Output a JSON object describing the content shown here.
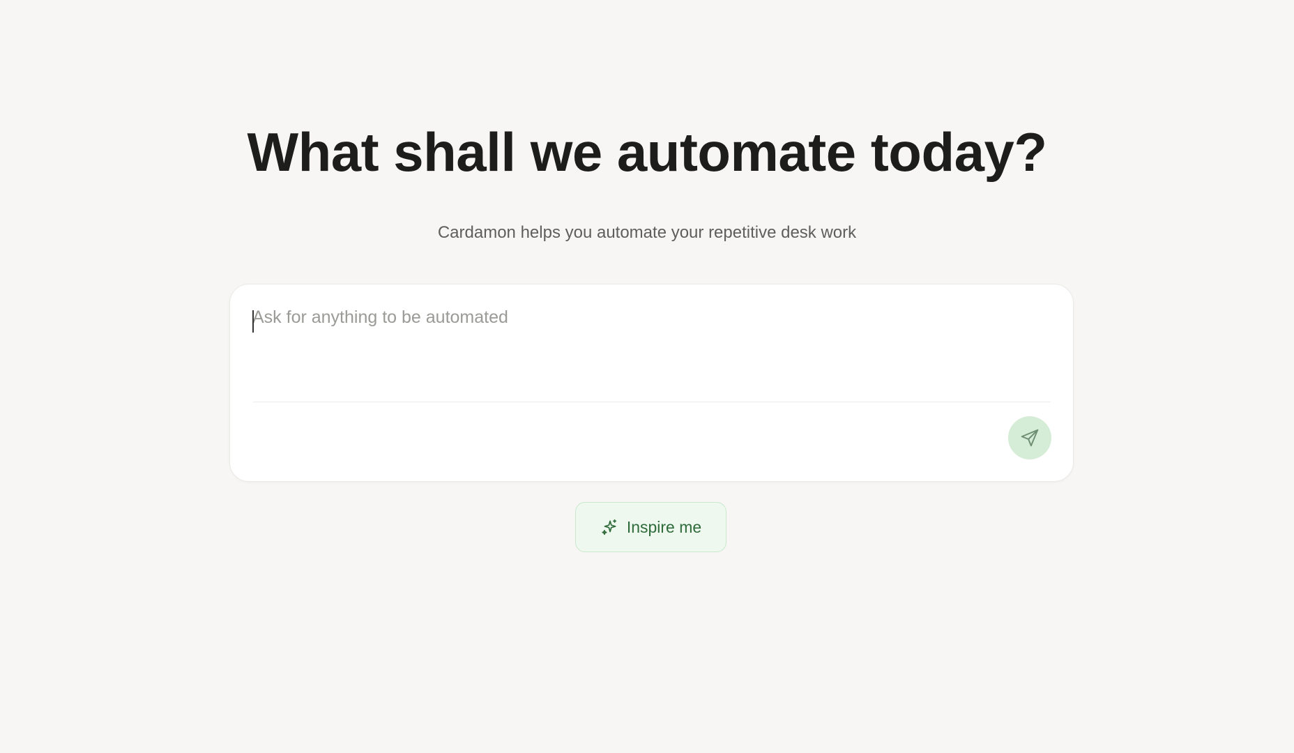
{
  "hero": {
    "title": "What shall we automate today?",
    "subtitle": "Cardamon helps you automate your repetitive desk work"
  },
  "composer": {
    "placeholder": "Ask for anything to be automated",
    "value": "",
    "send_icon": "send-icon"
  },
  "inspire": {
    "label": "Inspire me",
    "icon": "sparkles-icon"
  },
  "colors": {
    "background": "#f7f6f4",
    "send_button": "#d5ecd6",
    "inspire_bg": "#eef8ef",
    "inspire_text": "#2f6b3a"
  }
}
